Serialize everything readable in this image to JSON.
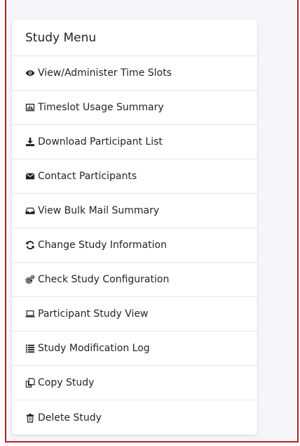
{
  "menu": {
    "title": "Study Menu",
    "items": [
      {
        "label": "View/Administer Time Slots",
        "icon": "eye-icon"
      },
      {
        "label": "Timeslot Usage Summary",
        "icon": "bar-chart-icon"
      },
      {
        "label": "Download Participant List",
        "icon": "download-icon"
      },
      {
        "label": "Contact Participants",
        "icon": "envelope-icon"
      },
      {
        "label": "View Bulk Mail Summary",
        "icon": "inbox-icon"
      },
      {
        "label": "Change Study Information",
        "icon": "refresh-icon"
      },
      {
        "label": "Check Study Configuration",
        "icon": "cogs-icon"
      },
      {
        "label": "Participant Study View",
        "icon": "laptop-icon"
      },
      {
        "label": "Study Modification Log",
        "icon": "list-icon"
      },
      {
        "label": "Copy Study",
        "icon": "copy-icon"
      },
      {
        "label": "Delete Study",
        "icon": "trash-icon"
      }
    ]
  },
  "colors": {
    "frame_border": "#b22222",
    "background": "#f4f6f9",
    "card": "#ffffff",
    "text": "#212529"
  }
}
